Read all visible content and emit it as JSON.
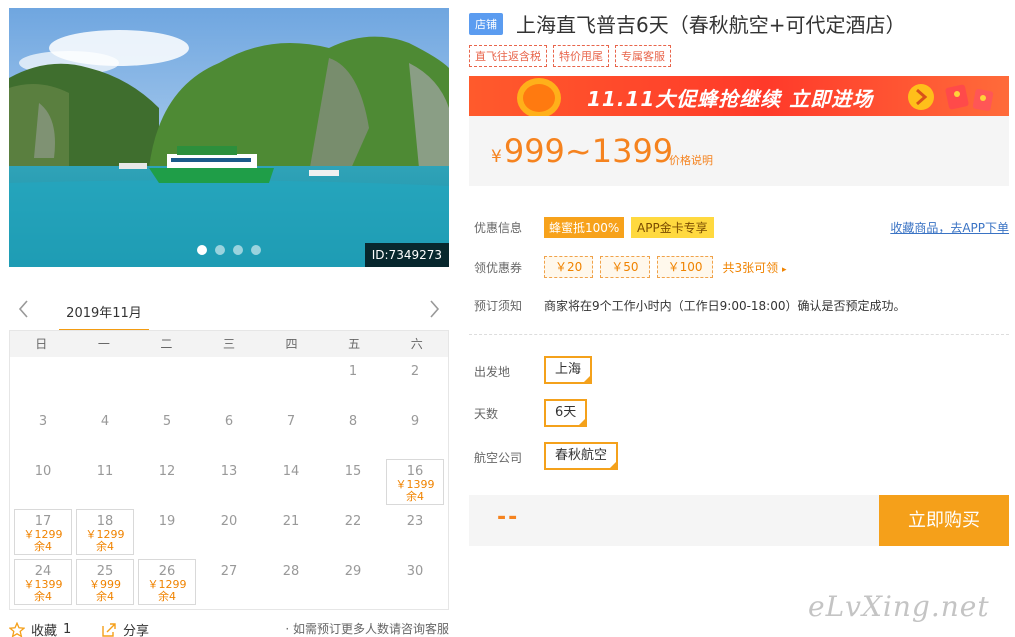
{
  "photo": {
    "id_label": "ID:7349273",
    "slide_count": 4,
    "active_slide": 1
  },
  "calendar": {
    "month_label": "2019年11月",
    "weekdays": [
      "日",
      "一",
      "二",
      "三",
      "四",
      "五",
      "六"
    ],
    "days": [
      {
        "d": ""
      },
      {
        "d": ""
      },
      {
        "d": ""
      },
      {
        "d": ""
      },
      {
        "d": ""
      },
      {
        "d": "1"
      },
      {
        "d": "2"
      },
      {
        "d": "3"
      },
      {
        "d": "4"
      },
      {
        "d": "5"
      },
      {
        "d": "6"
      },
      {
        "d": "7"
      },
      {
        "d": "8"
      },
      {
        "d": "9"
      },
      {
        "d": "10"
      },
      {
        "d": "11"
      },
      {
        "d": "12"
      },
      {
        "d": "13"
      },
      {
        "d": "14"
      },
      {
        "d": "15"
      },
      {
        "d": "16",
        "price": "￥1399",
        "stock": "余4"
      },
      {
        "d": "17",
        "price": "￥1299",
        "stock": "余4"
      },
      {
        "d": "18",
        "price": "￥1299",
        "stock": "余4"
      },
      {
        "d": "19"
      },
      {
        "d": "20"
      },
      {
        "d": "21"
      },
      {
        "d": "22"
      },
      {
        "d": "23"
      },
      {
        "d": "24",
        "price": "￥1399",
        "stock": "余4"
      },
      {
        "d": "25",
        "price": "￥999",
        "stock": "余4"
      },
      {
        "d": "26",
        "price": "￥1299",
        "stock": "余4"
      },
      {
        "d": "27"
      },
      {
        "d": "28"
      },
      {
        "d": "29"
      },
      {
        "d": "30"
      }
    ]
  },
  "footer": {
    "fav_label": "收藏",
    "fav_count": "1",
    "share_label": "分享",
    "consult": "· 如需预订更多人数请咨询客服"
  },
  "product": {
    "shop_badge": "店铺",
    "title": "上海直飞普吉6天（春秋航空+可代定酒店）",
    "tags": [
      "直飞往返含税",
      "特价甩尾",
      "专属客服"
    ],
    "banner_text": "11.11大促蜂抢继续 立即进场",
    "price_symbol": "¥",
    "price_range": "999~1399",
    "price_note": "价格说明"
  },
  "promo": {
    "label": "优惠信息",
    "badge1": "蜂蜜抵100%",
    "badge2": "APP金卡专享",
    "fav_link": "收藏商品，去APP下单"
  },
  "coupons": {
    "label": "领优惠券",
    "items": [
      "￥20",
      "￥50",
      "￥100"
    ],
    "more": "共3张可领"
  },
  "booking": {
    "label": "预订须知",
    "text": "商家将在9个工作小时内（工作日9:00-18:00）确认是否预定成功。"
  },
  "options": {
    "departure_label": "出发地",
    "departure_value": "上海",
    "days_label": "天数",
    "days_value": "6天",
    "airline_label": "航空公司",
    "airline_value": "春秋航空"
  },
  "buy": {
    "price": "--",
    "button": "立即购买"
  },
  "watermark": "eLvXing.net",
  "colors": {
    "accent": "#f5a01a",
    "price": "#f5831f",
    "tag": "#e8654b",
    "banner": "#ff3a2a"
  }
}
